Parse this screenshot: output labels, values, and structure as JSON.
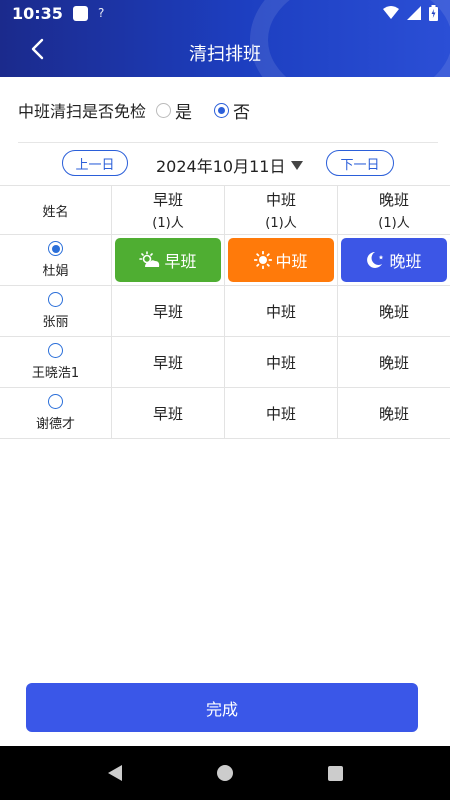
{
  "status_bar": {
    "time": "10:35",
    "wifi_question": "?"
  },
  "nav": {
    "title": "清扫排班"
  },
  "exempt": {
    "label": "中班清扫是否免检",
    "options": [
      {
        "label": "是",
        "checked": false
      },
      {
        "label": "否",
        "checked": true
      }
    ]
  },
  "date_bar": {
    "prev_label": "上一日",
    "date": "2024年10月11日",
    "next_label": "下一日"
  },
  "table": {
    "name_header": "姓名",
    "shifts": [
      {
        "label": "早班",
        "count": "(1)人"
      },
      {
        "label": "中班",
        "count": "(1)人"
      },
      {
        "label": "晚班",
        "count": "(1)人"
      }
    ],
    "rows": [
      {
        "name": "杜娟",
        "selected": true,
        "cells": [
          "早班",
          "中班",
          "晚班"
        ]
      },
      {
        "name": "张丽",
        "selected": false,
        "cells": [
          "早班",
          "中班",
          "晚班"
        ]
      },
      {
        "name": "王晓浩1",
        "selected": false,
        "cells": [
          "早班",
          "中班",
          "晚班"
        ]
      },
      {
        "name": "谢德才",
        "selected": false,
        "cells": [
          "早班",
          "中班",
          "晚班"
        ]
      }
    ]
  },
  "colors": {
    "primary": "#3a57e8",
    "morning": "#4fae32",
    "middle": "#ff7a0a",
    "night": "#3c56e6"
  },
  "footer": {
    "finish_label": "完成"
  }
}
